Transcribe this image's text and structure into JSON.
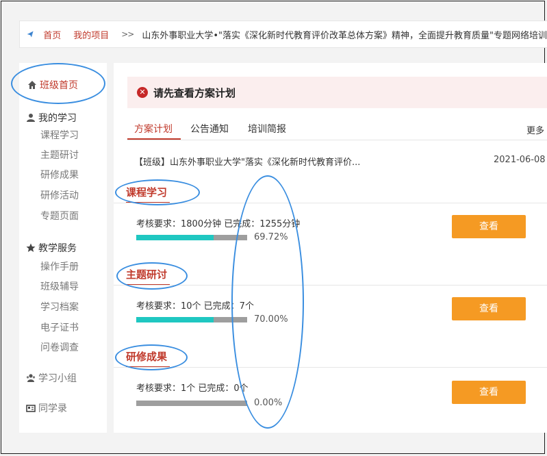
{
  "breadcrumb": {
    "home": "首页",
    "project": "我的项目",
    "separator": ">>",
    "current": "山东外事职业大学•\"落实《深化新时代教育评价改革总体方案》精神，全面提升教育质量\"专题网络培训"
  },
  "sidebar": {
    "home": "班级首页",
    "my_study": {
      "title": "我的学习",
      "items": [
        "课程学习",
        "主题研讨",
        "研修成果",
        "研修活动",
        "专题页面"
      ]
    },
    "teaching": {
      "title": "教学服务",
      "items": [
        "操作手册",
        "班级辅导",
        "学习档案",
        "电子证书",
        "问卷调查"
      ]
    },
    "group": "学习小组",
    "classmates": "同学录"
  },
  "alert": {
    "text": "请先查看方案计划"
  },
  "tabs": {
    "items": [
      "方案计划",
      "公告通知",
      "培训简报"
    ],
    "more": "更多"
  },
  "notice": {
    "title": "【班级】山东外事职业大学\"落实《深化新时代教育评价...",
    "date": "2021-06-08"
  },
  "sections": [
    {
      "title": "课程学习",
      "requirement": "考核要求：1800分钟 已完成：1255分钟",
      "progress": 0.6972,
      "percent_text": "69.72%",
      "button": "查看"
    },
    {
      "title": "主题研讨",
      "requirement": "考核要求：10个 已完成：7个",
      "progress": 0.7,
      "percent_text": "70.00%",
      "button": "查看"
    },
    {
      "title": "研修成果",
      "requirement": "考核要求：1个 已完成：0个",
      "progress": 0.0,
      "percent_text": "0.00%",
      "button": "查看"
    }
  ],
  "colors": {
    "accent_red": "#c0392b",
    "button_orange": "#f59a23",
    "progress_teal": "#1fc7c1",
    "annotation_blue": "#3a8ee0"
  }
}
